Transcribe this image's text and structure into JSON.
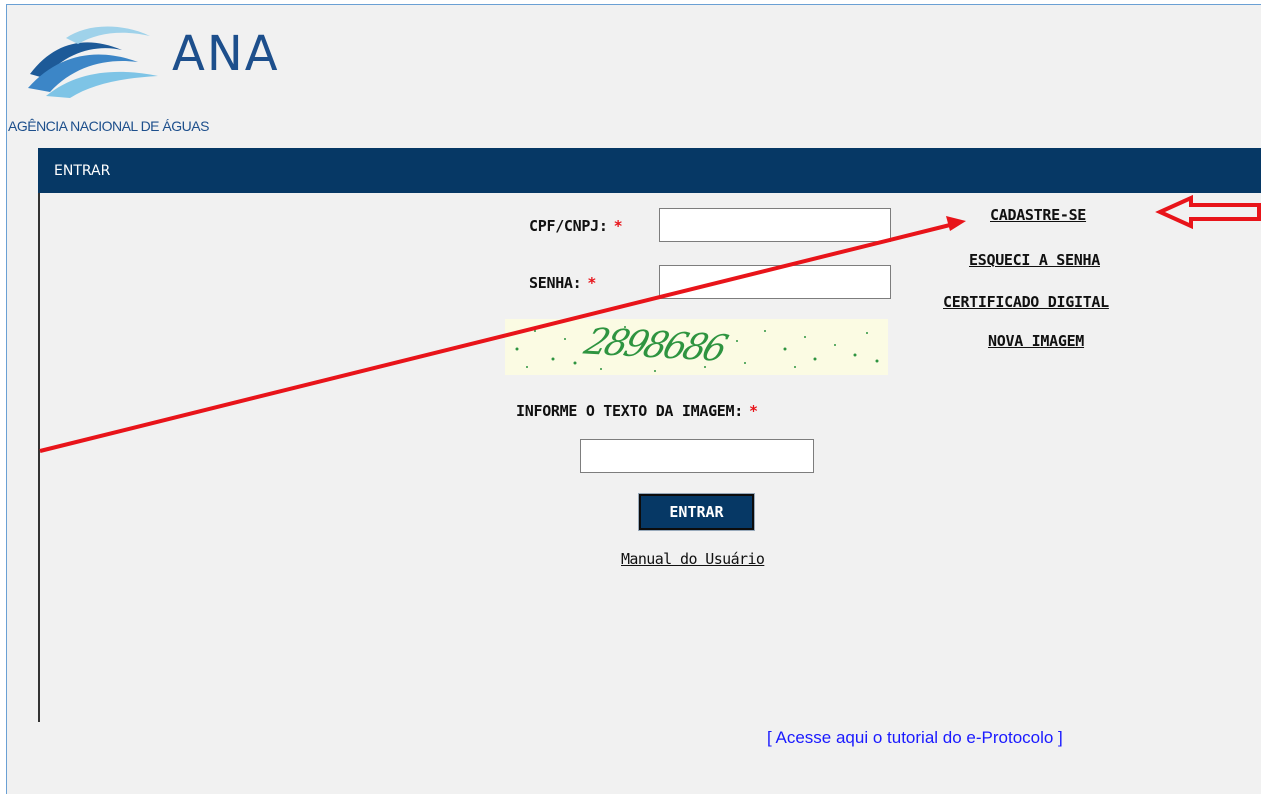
{
  "logo": {
    "title": "ANA",
    "subtitle": "AGÊNCIA NACIONAL DE ÁGUAS",
    "icon": "waves-logo-icon"
  },
  "panel": {
    "title": "ENTRAR"
  },
  "form": {
    "cpf_label": "CPF/CNPJ:",
    "senha_label": "SENHA:",
    "captcha_label": "INFORME O TEXTO DA IMAGEM:",
    "required_mark": "*",
    "captcha_text": "2898686",
    "submit_label": "ENTRAR",
    "manual_link": "Manual do Usuário",
    "cpf_value": "",
    "senha_value": "",
    "captcha_value": ""
  },
  "side_links": {
    "register": "CADASTRE-SE",
    "forgot_password": "ESQUECI A SENHA",
    "digital_certificate": "CERTIFICADO DIGITAL",
    "new_image": "NOVA IMAGEM"
  },
  "footer": {
    "tutorial_link": "[ Acesse aqui o tutorial do e-Protocolo ]"
  },
  "annotation": {
    "color": "#e8141a",
    "icons": [
      "arrow-pointer-line",
      "hollow-arrow-icon"
    ]
  }
}
